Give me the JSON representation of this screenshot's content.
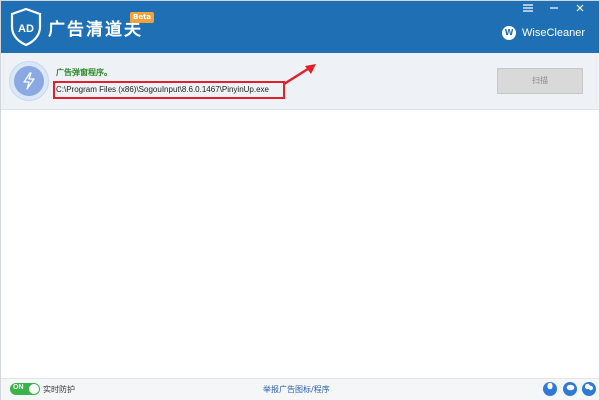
{
  "window": {
    "title": "广告清道夫",
    "badge": "Beta",
    "controls": {
      "menu_icon": "menu-icon",
      "minimize_icon": "minimize-icon",
      "close_icon": "close-icon"
    },
    "brand": {
      "mark": "W",
      "name": "WiseCleaner"
    },
    "colors": {
      "titlebar": "#1f6fb4",
      "accent_green": "#2e8b2e",
      "highlight_red": "#e0202a"
    }
  },
  "status": {
    "icon": "lightning-shield-icon",
    "title": "广告弹窗程序。",
    "path": "C:\\Program Files (x86)\\SogouInput\\8.6.0.1467\\PinyinUp.exe",
    "scan_label": "扫描"
  },
  "footer": {
    "toggle_label": "ON",
    "realtime_label": "实时防护",
    "report_link": "举报广告图标/程序",
    "icons": [
      "qq-icon",
      "weibo-icon",
      "wechat-icon"
    ]
  }
}
